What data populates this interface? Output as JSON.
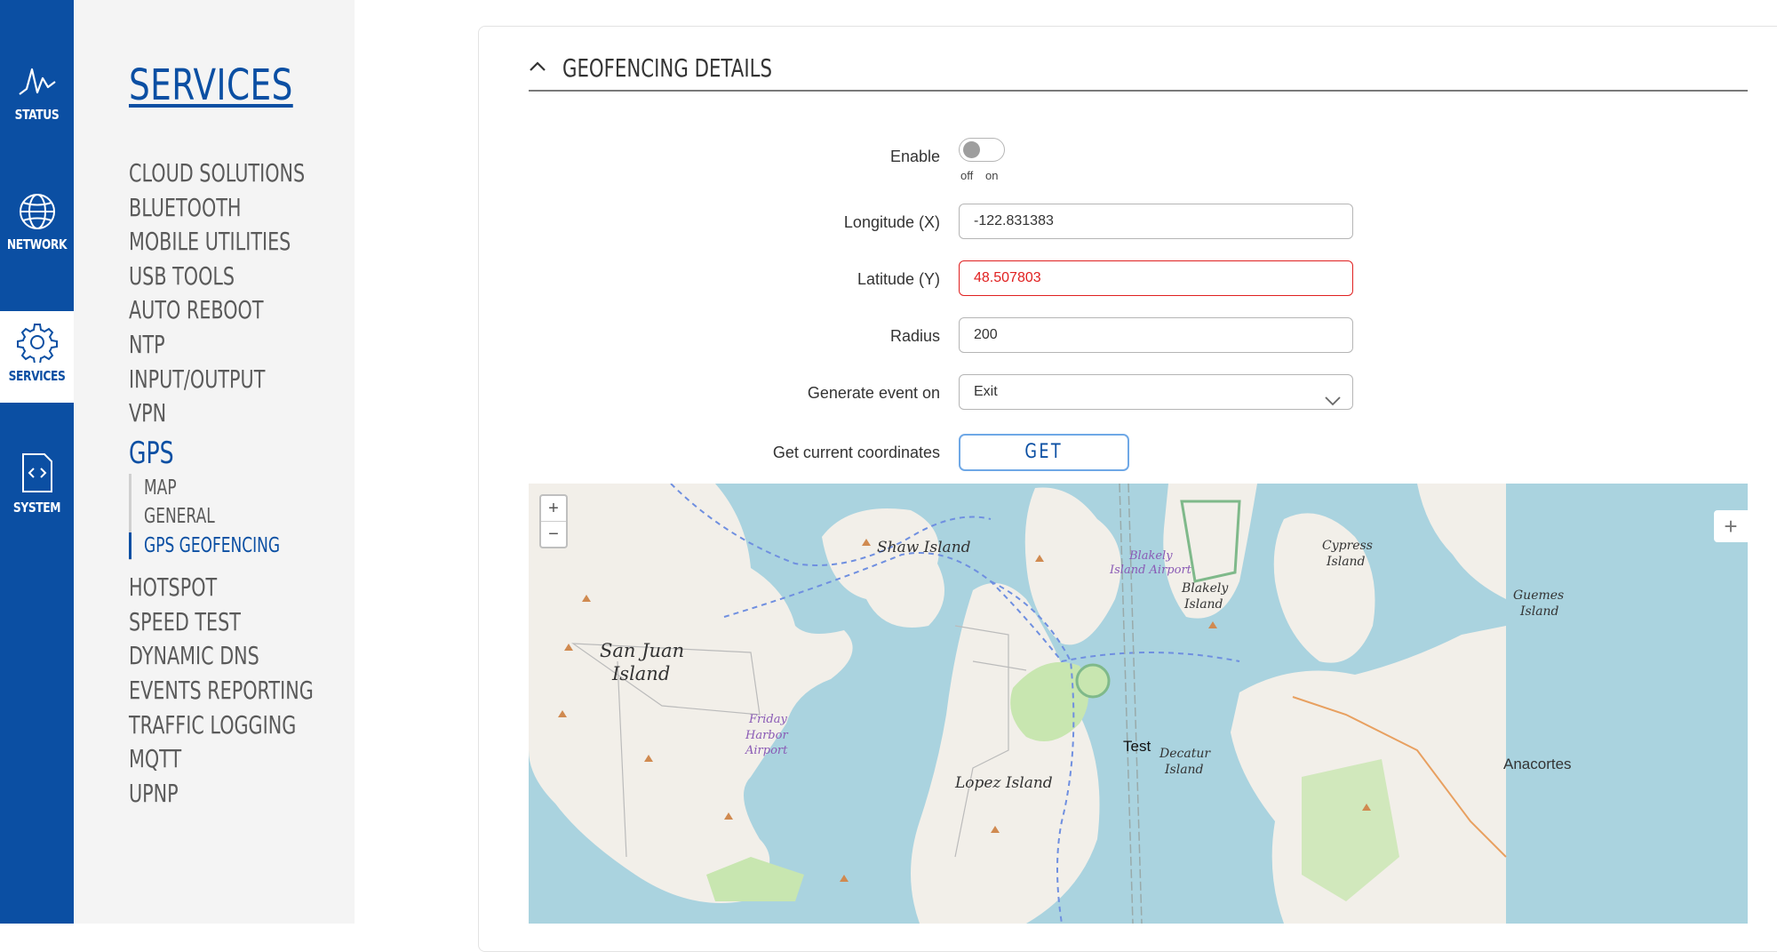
{
  "rail": {
    "items": [
      {
        "label": "STATUS",
        "icon": "activity-icon"
      },
      {
        "label": "NETWORK",
        "icon": "globe-icon"
      },
      {
        "label": "SERVICES",
        "icon": "gear-icon"
      },
      {
        "label": "SYSTEM",
        "icon": "code-file-icon"
      }
    ]
  },
  "sidebar": {
    "title": "SERVICES",
    "items_top": [
      "CLOUD SOLUTIONS",
      "BLUETOOTH",
      "MOBILE UTILITIES",
      "USB TOOLS",
      "AUTO REBOOT",
      "NTP",
      "INPUT/OUTPUT",
      "VPN"
    ],
    "active": "GPS",
    "subitems": [
      "MAP",
      "GENERAL",
      "GPS GEOFENCING"
    ],
    "active_subitem": "GPS GEOFENCING",
    "items_bottom": [
      "HOTSPOT",
      "SPEED TEST",
      "DYNAMIC DNS",
      "EVENTS REPORTING",
      "TRAFFIC LOGGING",
      "MQTT",
      "UPNP"
    ]
  },
  "section": {
    "title": "GEOFENCING DETAILS"
  },
  "form": {
    "enable_label": "Enable",
    "enable_value": false,
    "toggle_off": "off",
    "toggle_on": "on",
    "longitude_label": "Longitude (X)",
    "longitude_value": "-122.831383",
    "latitude_label": "Latitude (Y)",
    "latitude_value": "48.507803",
    "radius_label": "Radius",
    "radius_value": "200",
    "event_label": "Generate event on",
    "event_value": "Exit",
    "coords_label": "Get current coordinates",
    "get_button": "GET"
  },
  "map": {
    "zoom_in": "+",
    "zoom_out": "−",
    "draw_button": "+",
    "marker_label": "Test",
    "labels": {
      "shaw": "Shaw Island",
      "blakely_airport_1": "Blakely",
      "blakely_airport_2": "Island Airport",
      "blakely_1": "Blakely",
      "blakely_2": "Island",
      "cypress_1": "Cypress",
      "cypress_2": "Island",
      "guemes_1": "Guemes",
      "guemes_2": "Island",
      "sanjuan_1": "San Juan",
      "sanjuan_2": "Island",
      "friday_1": "Friday",
      "friday_2": "Harbor",
      "friday_3": "Airport",
      "lopez": "Lopez Island",
      "decatur_1": "Decatur",
      "decatur_2": "Island",
      "anacortes": "Anacortes"
    }
  },
  "colors": {
    "brand": "#0b4fa3",
    "error": "#e02020",
    "water": "#aad3df",
    "land": "#f2efe9",
    "park": "#c8e6b0"
  }
}
